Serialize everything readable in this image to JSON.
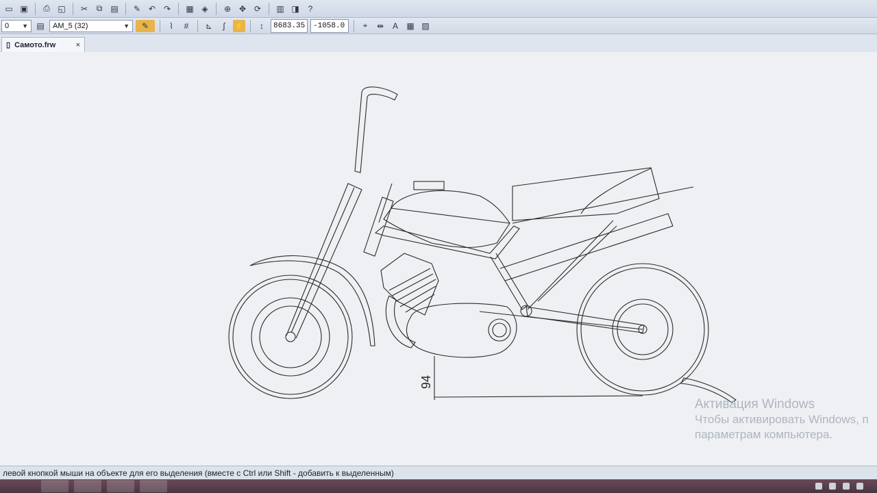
{
  "document_tab": {
    "label": "Самото.frw",
    "close": "×"
  },
  "coordinates": {
    "x": "8683.35",
    "y": "-1058.0"
  },
  "layer_combo": {
    "value": "0"
  },
  "style_combo": {
    "value": "AM_5 (32)"
  },
  "dimension": {
    "value": "94"
  },
  "status": {
    "text": "левой кнопкой мыши на объекте для его выделения (вместе с Ctrl или Shift - добавить к выделенным)"
  },
  "watermark": {
    "title": "Активация Windows",
    "line1": "Чтобы активировать Windows, п",
    "line2": "параметрам компьютера."
  },
  "icons": [
    "save-icon",
    "print-icon",
    "cut-icon",
    "copy-icon",
    "paste-icon",
    "undo-icon",
    "redo-icon",
    "grid-icon",
    "snap-icon",
    "ortho-icon",
    "coord-icon"
  ]
}
